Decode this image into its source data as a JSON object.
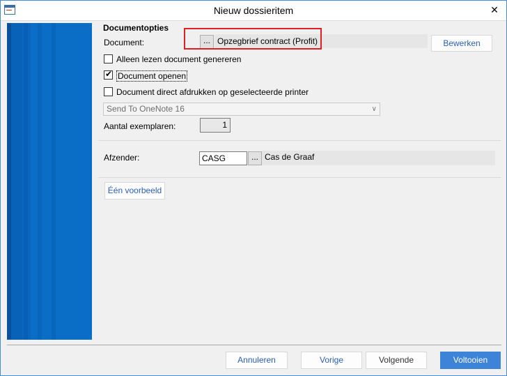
{
  "window": {
    "title": "Nieuw dossieritem",
    "close_glyph": "✕"
  },
  "section": {
    "title": "Documentopties"
  },
  "document": {
    "label": "Document:",
    "browse": "...",
    "value": "Opzegbrief contract (Profit)",
    "edit_button": "Bewerken"
  },
  "options": {
    "readonly": {
      "label": "Alleen lezen document genereren",
      "checked": false
    },
    "open": {
      "label": "Document openen",
      "checked": true
    },
    "print": {
      "label": "Document direct afdrukken op geselecteerde printer",
      "checked": false
    }
  },
  "printer": {
    "selected": "Send To OneNote 16"
  },
  "copies": {
    "label": "Aantal exemplaren:",
    "value": "1"
  },
  "sender": {
    "label": "Afzender:",
    "code": "CASG",
    "browse": "...",
    "name": "Cas de Graaf"
  },
  "preview_button": "Één voorbeeld",
  "footer": {
    "cancel": "Annuleren",
    "back": "Vorige",
    "next": "Volgende",
    "finish": "Voltooien"
  },
  "colors": {
    "accent": "#3d83d8",
    "side_panel": "#0a6ec6",
    "highlight": "#e02020"
  }
}
